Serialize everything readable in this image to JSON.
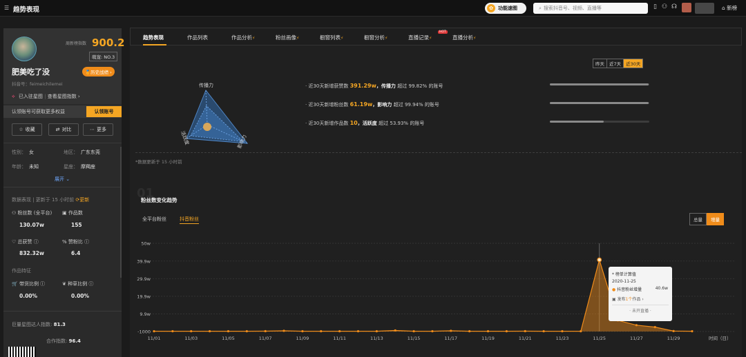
{
  "topbar": {
    "title": "趋势表现",
    "func_label": "功能速图",
    "search_placeholder": "搜索抖音号、视频、直播等",
    "new_label": "新榜"
  },
  "profile": {
    "score_label": "周新榜指数",
    "score": "900.2",
    "rank": "萌宠: NO.3",
    "name": "肥美吃了没",
    "history_btn": "历史战绩 ›",
    "douyin_id": "抖音号：feimeichilemei",
    "star_status": "已入驻星图",
    "star_link": "查看星图指数 ›",
    "cert_text": "认领账号可获取更多权益",
    "cert_btn": "认领账号",
    "actions": [
      "收藏",
      "对比",
      "更多"
    ],
    "gender_label": "性别：",
    "gender": "女",
    "region_label": "地区：",
    "region": "广东东莞",
    "age_label": "年龄：",
    "age": "未知",
    "sign_label": "星座：",
    "sign": "摩羯座",
    "expand": "展开 ⌄",
    "data_section": "数据表现 | 更新于 15 小时前",
    "data_update": "⟳更新",
    "fans_label": "粉丝数 (全平台)",
    "fans": "130.07w",
    "works_label": "作品数",
    "works": "155",
    "likes_label": "总获赞",
    "likes": "832.32w",
    "ratio_label": "赞粉比",
    "ratio": "6.4",
    "feature_section": "作品特征",
    "carry_label": "带货比例",
    "carry": "0.00%",
    "grass_label": "种草比例",
    "grass": "0.00%",
    "star_index_label": "巨量星图达人指数:",
    "star_index": "81.3",
    "coop_label": "合作指数:",
    "coop": "96.4"
  },
  "tabs": [
    "趋势表现",
    "作品列表",
    "作品分析",
    "粉丝画像",
    "橱窗列表",
    "橱窗分析",
    "直播记录",
    "直播分析"
  ],
  "hot_label": "HOT",
  "radar": {
    "labels": [
      "传播力",
      "活跃度",
      "影响力"
    ],
    "values": [
      0.55,
      0.8,
      0.9
    ]
  },
  "day_options": [
    "昨天",
    "近7天",
    "近30天"
  ],
  "stats": [
    {
      "prefix": "· 近30天新增获赞数 ",
      "value": "391.29w",
      "mid": "，传播力 ",
      "tail": "超过 99.82% 的账号",
      "bar": 0.99
    },
    {
      "prefix": "· 近30天新增粉丝数 ",
      "value": "61.19w",
      "mid": "，影响力 ",
      "tail": "超过 99.94% 的账号",
      "bar": 0.99
    },
    {
      "prefix": "· 近30天新增作品数 ",
      "value": "10",
      "mid": "，活跃度 ",
      "tail": "超过 53.93% 的账号",
      "bar": 0.54
    }
  ],
  "updated_note": "*数据更新于 15 小时前",
  "section_num": "01",
  "chart_title": "粉丝数变化趋势",
  "subtabs": [
    "全平台粉丝",
    "抖音粉丝"
  ],
  "mode_options": [
    "总量",
    "增量"
  ],
  "tooltip": {
    "note": "* 榜单计算值",
    "date": "2020-11-25",
    "series": "抖音粉丝增量",
    "value": "40.6w",
    "pub_pre": "发布",
    "pub_num": "1个",
    "pub_post": "作品 ›",
    "live": "· 未开直播 ·"
  },
  "chart_data": {
    "type": "line",
    "x": [
      "11/01",
      "11/02",
      "11/03",
      "11/04",
      "11/05",
      "11/06",
      "11/07",
      "11/08",
      "11/09",
      "11/10",
      "11/11",
      "11/12",
      "11/13",
      "11/14",
      "11/15",
      "11/16",
      "11/17",
      "11/18",
      "11/19",
      "11/20",
      "11/21",
      "11/22",
      "11/23",
      "11/24",
      "11/25",
      "11/26",
      "11/27",
      "11/28",
      "11/29",
      "11/30"
    ],
    "x_tick_labels": [
      "11/01",
      "11/03",
      "11/05",
      "11/07",
      "11/09",
      "11/11",
      "11/13",
      "11/15",
      "11/17",
      "11/19",
      "11/21",
      "11/23",
      "11/25",
      "11/27",
      "11/29"
    ],
    "series": [
      {
        "name": "抖音粉丝增量",
        "values": [
          0.05,
          0.05,
          0.05,
          0.05,
          0.05,
          0.05,
          0.1,
          0.3,
          0.05,
          0.05,
          0.05,
          0.05,
          0.05,
          0.5,
          0.05,
          0.05,
          0.3,
          0.05,
          0.05,
          0.05,
          0.1,
          0.05,
          0.05,
          0.05,
          40.6,
          6.2,
          3.5,
          2.4,
          0.15,
          0.05
        ]
      }
    ],
    "y_ticks": [
      "-1000",
      "9.9w",
      "19.9w",
      "29.9w",
      "39.9w",
      "50w"
    ],
    "y_tick_values": [
      -0.1,
      9.9,
      19.9,
      29.9,
      39.9,
      50
    ],
    "ylim": [
      -0.1,
      50
    ],
    "xlabel": "时间（日）",
    "highlight_index": 24,
    "color": "#f08c1a"
  }
}
